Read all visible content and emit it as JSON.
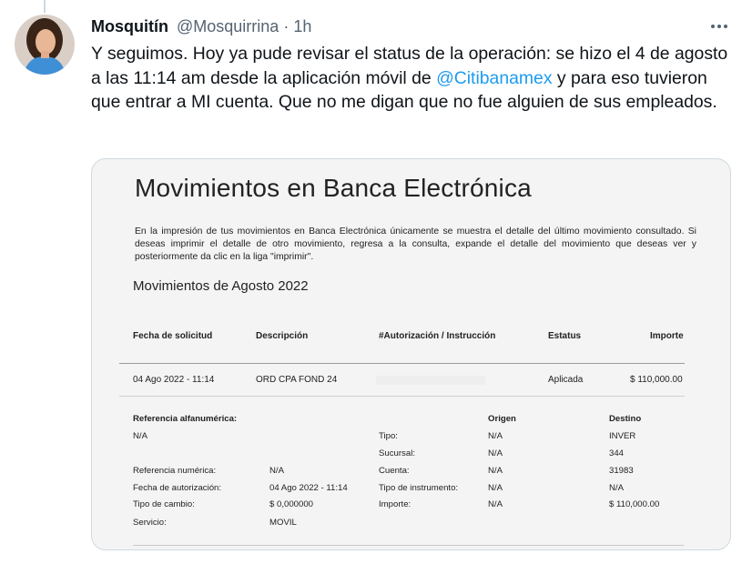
{
  "tweet": {
    "author_name": "Mosquitín",
    "author_handle": "@Mosquirrina",
    "separator": "·",
    "time": "1h",
    "text_before": "Y seguimos. Hoy ya pude revisar el status de la operación: se hizo el 4 de agosto a las 11:14 am desde la aplicación móvil de ",
    "mention": "@Citibanamex",
    "text_after": " y para eso tuvieron que entrar a MI cuenta. Que no me digan que no fue alguien de sus empleados."
  },
  "colors": {
    "mention": "#1d9bf0",
    "muted": "#536471",
    "text": "#0f1419"
  },
  "icons": {
    "more": "more-horizontal-icon"
  },
  "document": {
    "title": "Movimientos en Banca Electrónica",
    "intro": "En la impresión de tus movimientos en Banca Electrónica únicamente se muestra el detalle del último movimiento consultado. Si deseas imprimir el detalle de otro movimiento, regresa a la consulta, expande el detalle del movimiento que deseas ver y posteriormente da clic en la liga \"imprimir\".",
    "subtitle": "Movimientos de Agosto 2022",
    "columns": [
      "Fecha de solicitud",
      "Descripción",
      "#Autorización / Instrucción",
      "Estatus",
      "Importe"
    ],
    "row": {
      "fecha": "04 Ago 2022 - 11:14",
      "descripcion": "ORD CPA FOND 24",
      "estatus": "Aplicada",
      "importe": "$ 110,000.00"
    },
    "detail": {
      "ref_alfa_label": "Referencia alfanumérica:",
      "ref_alfa_value": "N/A",
      "ref_num_label": "Referencia numérica:",
      "ref_num_value": "N/A",
      "fecha_aut_label": "Fecha de autorización:",
      "fecha_aut_value": "04 Ago 2022 - 11:14",
      "tipo_cambio_label": "Tipo de cambio:",
      "tipo_cambio_value": "$ 0,000000",
      "servicio_label": "Servicio:",
      "servicio_value": "MOVIL",
      "origen_header": "Origen",
      "destino_header": "Destino",
      "tipo_label": "Tipo:",
      "tipo_origen": "N/A",
      "tipo_destino": "INVER",
      "sucursal_label": "Sucursal:",
      "sucursal_origen": "N/A",
      "sucursal_destino": "344",
      "cuenta_label": "Cuenta:",
      "cuenta_origen": "N/A",
      "cuenta_destino": "31983",
      "tipo_instr_label": "Tipo de instrumento:",
      "tipo_instr_origen": "N/A",
      "tipo_instr_destino": "N/A",
      "importe_label": "Importe:",
      "importe_origen": "N/A",
      "importe_destino": "$ 110,000.00"
    }
  }
}
